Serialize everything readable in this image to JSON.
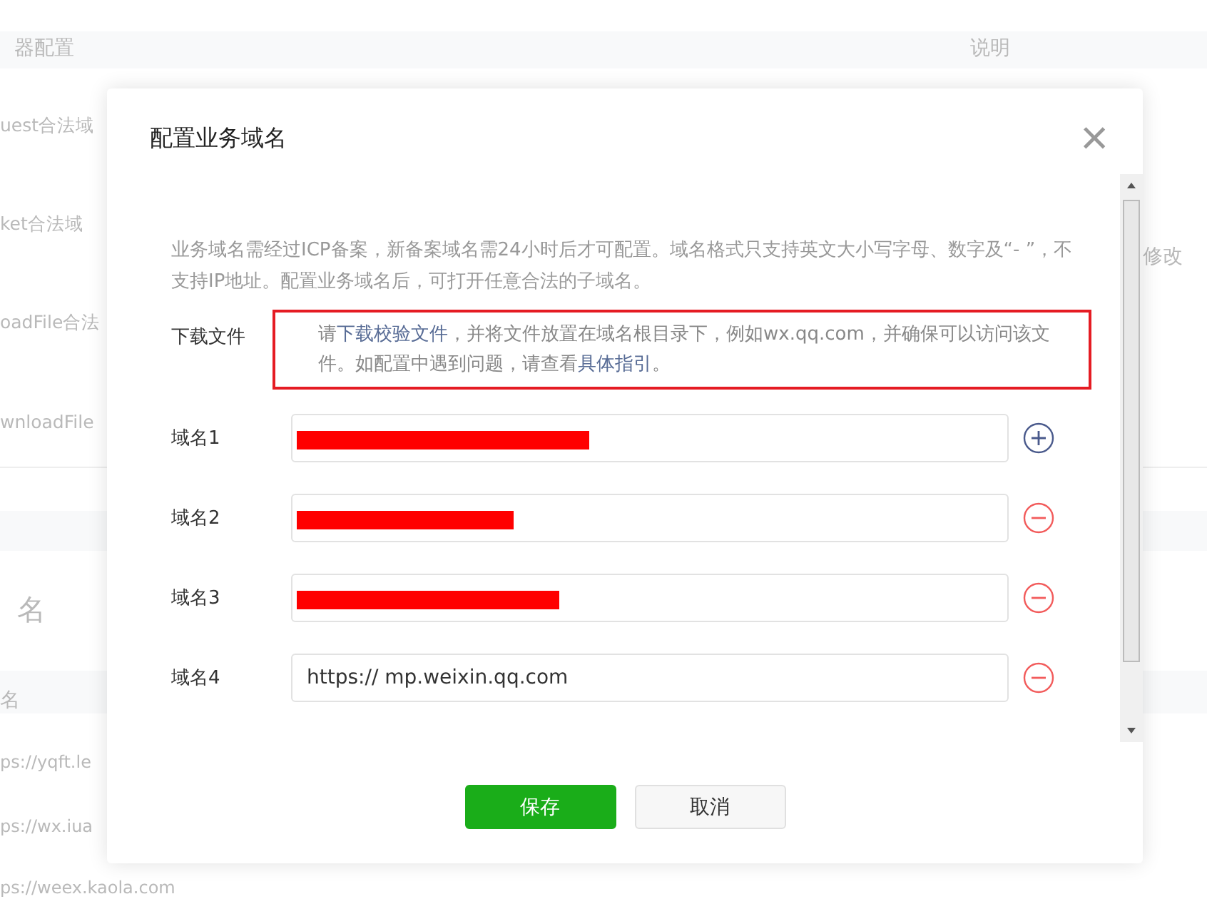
{
  "background": {
    "header": [
      "器配置",
      "说明"
    ],
    "rows": [
      "uest合法域",
      "ket合法域",
      "oadFile合法",
      "wnloadFile"
    ],
    "edit_link": "修改",
    "section_title": "名",
    "column_header": "名",
    "urls": [
      "ps://yqft.le",
      "ps://wx.iua",
      "ps://weex.kaola.com"
    ]
  },
  "dialog": {
    "title": "配置业务域名",
    "close": "×",
    "notice": "业务域名需经过ICP备案，新备案域名需24小时后才可配置。域名格式只支持英文大小写字母、数字及“- ”，不支持IP地址。配置业务域名后，可打开任意合法的子域名。",
    "download": {
      "label": "下载文件",
      "text": "请**下载校验文件**，并将文件放置在域名根目录下，例如wx.qq.com，并确保可以访问该文件。如配置中遇到问题，请查看**具体指引**。",
      "highlighted": true
    },
    "domains": [
      {
        "label": "域名1",
        "redacted": true,
        "addable": true
      },
      {
        "label": "域名2",
        "redacted": true,
        "addable": false
      },
      {
        "label": "域名3",
        "redacted": true,
        "addable": false
      },
      {
        "label": "域名4",
        "value": "https:// mp.weixin.qq.com",
        "redacted": false,
        "addable": false
      }
    ],
    "buttons": [
      {
        "label": "保存",
        "kind": "primary"
      },
      {
        "label": "取消",
        "kind": "secondary"
      }
    ]
  }
}
